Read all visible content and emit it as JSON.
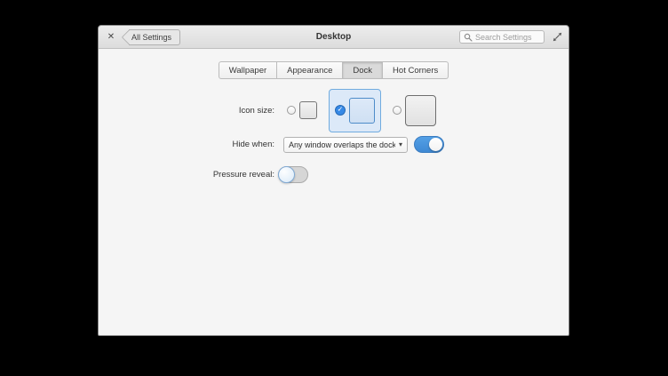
{
  "window": {
    "header": {
      "close_glyph": "✕",
      "back_label": "All Settings",
      "title": "Desktop",
      "search": {
        "placeholder": "Search Settings",
        "value": ""
      }
    },
    "tabs": [
      {
        "label": "Wallpaper",
        "selected": false
      },
      {
        "label": "Appearance",
        "selected": false
      },
      {
        "label": "Dock",
        "selected": true
      },
      {
        "label": "Hot Corners",
        "selected": false
      }
    ],
    "panel": {
      "icon_size": {
        "label": "Icon size:",
        "check_glyph": "✓",
        "options": [
          {
            "name": "small",
            "selected": false
          },
          {
            "name": "medium",
            "selected": true
          },
          {
            "name": "large",
            "selected": false
          }
        ]
      },
      "hide_when": {
        "label": "Hide when:",
        "value": "Any window overlaps the dock",
        "dropdown_arrow": "▾",
        "switch_on": true
      },
      "pressure_reveal": {
        "label": "Pressure reveal:",
        "switch_on": false
      }
    },
    "colors": {
      "accent": "#3689e6",
      "switch_on_track": "#4796e2",
      "selected_option_bg": "#dce9f8",
      "selected_option_border": "#70abdf"
    }
  }
}
